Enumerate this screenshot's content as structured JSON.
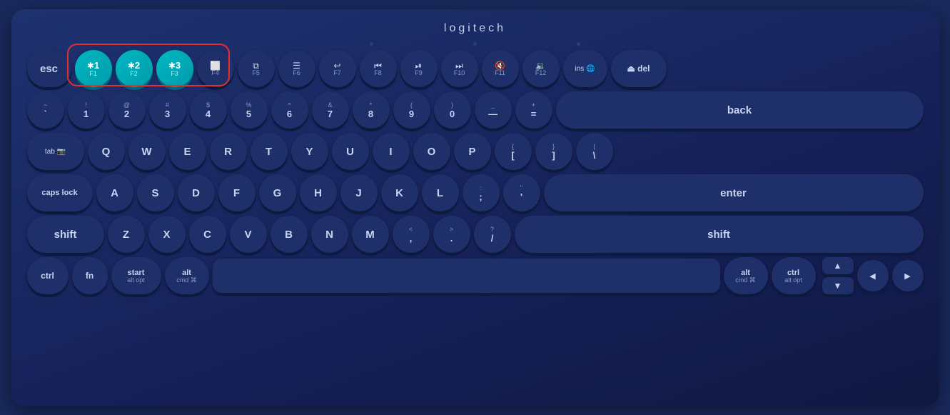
{
  "logo": "logitech",
  "keys": {
    "row0": {
      "esc": "esc",
      "f1": {
        "bt": true,
        "icon": "✱",
        "num": "1",
        "fn": "F1"
      },
      "f2": {
        "bt": true,
        "icon": "✱",
        "num": "2",
        "fn": "F2"
      },
      "f3": {
        "bt": true,
        "icon": "✱",
        "num": "3",
        "fn": "F3"
      },
      "f4": {
        "icon": "⬜",
        "fn": "F4"
      },
      "f5": {
        "icon": "⧉",
        "fn": "F5"
      },
      "f6": {
        "icon": "☰",
        "fn": "F6"
      },
      "f7": {
        "icon": "↩",
        "fn": "F7"
      },
      "f8": {
        "icon": "◀◀",
        "fn": "F8"
      },
      "f9": {
        "icon": "▶⏸",
        "fn": "F9"
      },
      "f10": {
        "icon": "▶▶",
        "fn": "F10"
      },
      "f11": {
        "icon": "🔇",
        "fn": "F11"
      },
      "f12": {
        "icon": "🔉",
        "fn": "F12"
      },
      "ins": "ins",
      "del": "del"
    },
    "bt_highlight": {
      "label": "highlighted bluetooth keys F1-F3"
    }
  }
}
